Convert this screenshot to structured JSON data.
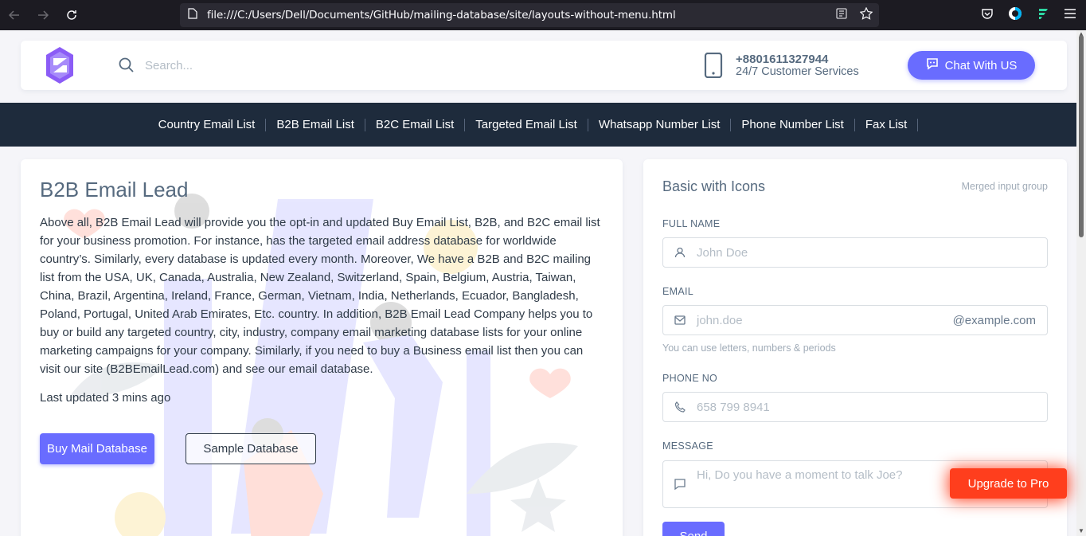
{
  "browser": {
    "url": "file:///C:/Users/Dell/Documents/GitHub/mailing-database/site/layouts-without-menu.html"
  },
  "header": {
    "search_placeholder": "Search...",
    "phone_number": "+8801611327944",
    "phone_sub": "24/7 Customer Services",
    "chat_button": "Chat With US"
  },
  "nav": {
    "items": [
      {
        "label": "Country Email List"
      },
      {
        "label": "B2B Email List"
      },
      {
        "label": "B2C Email List"
      },
      {
        "label": "Targeted Email List"
      },
      {
        "label": "Whatsapp Number List"
      },
      {
        "label": "Phone Number List"
      },
      {
        "label": "Fax List"
      }
    ]
  },
  "hero": {
    "title": "B2B Email Lead",
    "body": "Above all, B2B Email Lead will provide you the opt-in and updated Buy Email List, B2B, and B2C email list for your business promotion. For instance, has the targeted email address database for worldwide country’s. Similarly, every database is updated every month. Moreover, We have a B2B and B2C mailing list from the USA, UK, Canada, Australia, New Zealand, Switzerland, Spain, Belgium, Austria, Taiwan, China, Brazil, Argentina, Ireland, France, German, Vietnam, India, Netherlands, Ecuador, Bangladesh, Poland, Portugal, United Arab Emirates, Etc. country. In addition, B2B Email Lead Company helps you to buy or build any targeted country, city, industry, company email marketing database lists for your online marketing campaigns for your company. Similarly, if you need to buy a Business email list then you can visit our site (B2BEmailLead.com) and see our email database.",
    "updated": "Last updated 3 mins ago",
    "primary_button": "Buy Mail Database",
    "secondary_button": "Sample Database"
  },
  "form": {
    "title": "Basic with Icons",
    "subtitle": "Merged input group",
    "full_name_label": "FULL NAME",
    "full_name_placeholder": "John Doe",
    "email_label": "EMAIL",
    "email_placeholder": "john.doe",
    "email_suffix": "@example.com",
    "email_help": "You can use letters, numbers & periods",
    "phone_label": "PHONE NO",
    "phone_placeholder": "658 799 8941",
    "message_label": "MESSAGE",
    "message_placeholder": "Hi, Do you have a moment to talk Joe?",
    "send_button": "Send"
  },
  "upgrade_button": "Upgrade to Pro",
  "colors": {
    "primary": "#696cff",
    "navbar": "#1e2b3c",
    "upgrade": "#ff3e1d"
  }
}
